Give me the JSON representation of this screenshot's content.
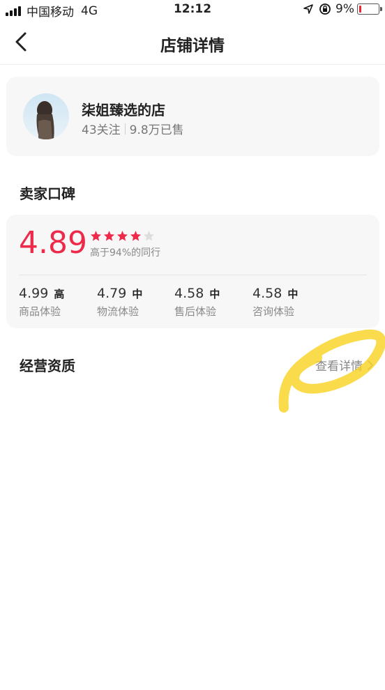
{
  "status_bar": {
    "carrier": "中国移动",
    "network": "4G",
    "time": "12:12",
    "battery": "9%"
  },
  "nav": {
    "title": "店铺详情",
    "back_icon": "chevron-left-icon"
  },
  "shop": {
    "name": "柒姐臻选的店",
    "followers": "43关注",
    "sold": "9.8万已售"
  },
  "reputation": {
    "section_title": "卖家口碑",
    "score": "4.89",
    "stars_filled": 4,
    "stars_total": 5,
    "above_text": "高于94%的同行",
    "accent_color": "#ee2a4a",
    "metrics": [
      {
        "value": "4.99",
        "level": "高",
        "label": "商品体验"
      },
      {
        "value": "4.79",
        "level": "中",
        "label": "物流体验"
      },
      {
        "value": "4.58",
        "level": "中",
        "label": "售后体验"
      },
      {
        "value": "4.58",
        "level": "中",
        "label": "咨询体验"
      }
    ]
  },
  "qualification": {
    "title": "经营资质",
    "link_label": "查看详情"
  }
}
